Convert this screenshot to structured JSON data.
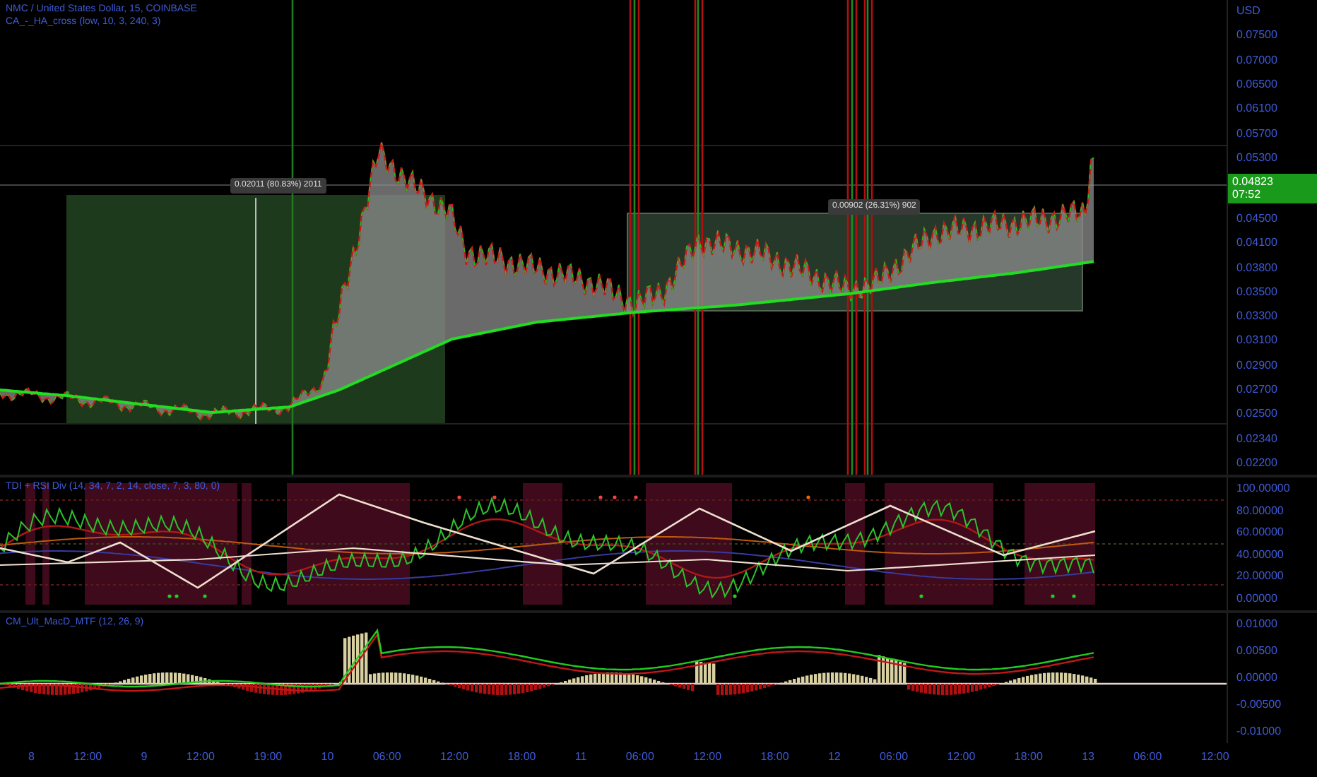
{
  "price_pane": {
    "legend": [
      "NMC / United States Dollar, 15, COINBASE",
      "CA_-_HA_cross (low, 10, 3, 240, 3)"
    ],
    "measurements": [
      "0.02011 (80.83%) 2011",
      "0.00902 (26.31%) 902"
    ],
    "axis_unit": "USD",
    "axis_labels_upper": [
      "0.07500",
      "0.07000",
      "0.06500",
      "0.06100",
      "0.05700",
      "0.05300"
    ],
    "last_price": {
      "price": "0.04823",
      "countdown": "07:52"
    },
    "axis_labels_lower": [
      "0.04500",
      "0.04100",
      "0.03800",
      "0.03500",
      "0.03300",
      "0.03100",
      "0.02900",
      "0.02700",
      "0.02500",
      "0.02340",
      "0.02200"
    ]
  },
  "rsi_pane": {
    "legend": "TDI + RSI Div (14, 34, 7, 2, 14, close, 7, 3, 80, 0)",
    "axis_labels": [
      "100.00000",
      "80.00000",
      "60.00000",
      "40.00000",
      "20.00000",
      "0.00000"
    ]
  },
  "macd_pane": {
    "legend": "CM_Ult_MacD_MTF (12, 26, 9)",
    "axis_labels": [
      "0.01000",
      "0.00500",
      "0.00000",
      "-0.00500",
      "-0.01000"
    ]
  },
  "time_axis": [
    "8",
    "12:00",
    "9",
    "12:00",
    "19:00",
    "10",
    "06:00",
    "12:00",
    "18:00",
    "11",
    "06:00",
    "12:00",
    "18:00",
    "12",
    "06:00",
    "12:00",
    "18:00",
    "13",
    "06:00",
    "12:00"
  ]
}
